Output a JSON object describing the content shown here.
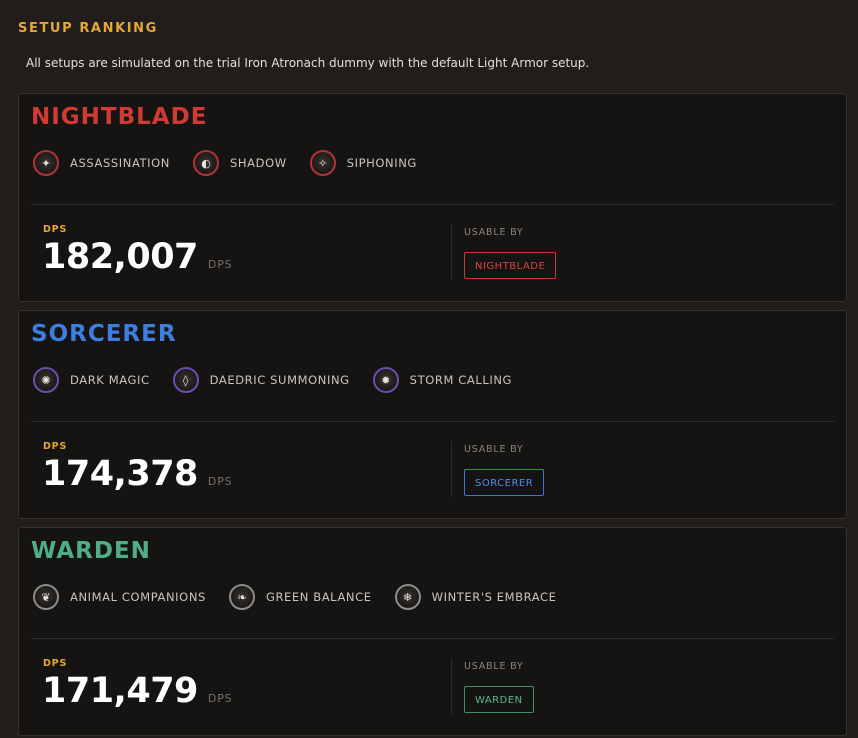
{
  "section_title": "SETUP RANKING",
  "intro": "All setups are simulated on the trial Iron Atronach dummy with the default Light Armor setup.",
  "labels": {
    "dps": "DPS",
    "dps_unit": "DPS",
    "usable_by": "USABLE BY"
  },
  "colors": {
    "accent": "#e6a833",
    "nightblade": "#cf3a35",
    "sorcerer": "#3d7fe0",
    "warden": "#4fae84"
  },
  "cards": [
    {
      "class_name": "NIGHTBLADE",
      "dps": "182,007",
      "usable_by": "NIGHTBLADE",
      "lines": [
        {
          "label": "ASSASSINATION",
          "icon": "assassination-icon"
        },
        {
          "label": "SHADOW",
          "icon": "shadow-icon"
        },
        {
          "label": "SIPHONING",
          "icon": "siphoning-icon"
        }
      ]
    },
    {
      "class_name": "SORCERER",
      "dps": "174,378",
      "usable_by": "SORCERER",
      "lines": [
        {
          "label": "DARK MAGIC",
          "icon": "dark-magic-icon"
        },
        {
          "label": "DAEDRIC SUMMONING",
          "icon": "daedric-summoning-icon"
        },
        {
          "label": "STORM CALLING",
          "icon": "storm-calling-icon"
        }
      ]
    },
    {
      "class_name": "WARDEN",
      "dps": "171,479",
      "usable_by": "WARDEN",
      "lines": [
        {
          "label": "ANIMAL COMPANIONS",
          "icon": "animal-companions-icon"
        },
        {
          "label": "GREEN BALANCE",
          "icon": "green-balance-icon"
        },
        {
          "label": "WINTER'S EMBRACE",
          "icon": "winters-embrace-icon"
        }
      ]
    }
  ]
}
